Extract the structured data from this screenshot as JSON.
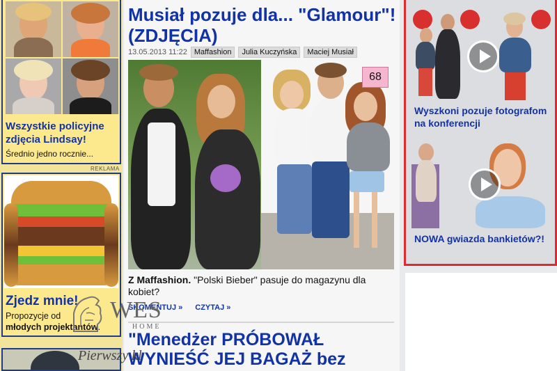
{
  "left": {
    "lindsay_headline": "Wszystkie policyjne zdjęcia Lindsay!",
    "lindsay_sub": "Średnio jedno rocznie...",
    "ad_label": "REKLAMA",
    "burger_title": "Zjedz mnie!",
    "burger_sub_plain": "Propozycje od",
    "burger_sub_bold": "młodych projektantów",
    "burger_sub_end": "."
  },
  "main": {
    "title": "Musiał pozuje dla... \"Glamour\"! (ZDJĘCIA)",
    "date": "13.05.2013 11:22",
    "tags": [
      "Maffashion",
      "Julia Kuczyńska",
      "Maciej Musiał"
    ],
    "photo_count": "68",
    "caption_bold": "Z Maffashion.",
    "caption_text": " \"Polski Bieber\" pasuje do magazynu dla kobiet?",
    "link_comment": "SKOMENTUJ »",
    "link_read": "CZYTAJ »",
    "second_title": "\"Menedżer PRÓBOWAŁ WYNIEŚĆ JEJ BAGAŻ bez"
  },
  "right": {
    "video1_title": "Wyszkoni pozuje fotografom na konferencji",
    "video2_title": "NOWA gwiazda bankietów?!",
    "ad_brand": "WES",
    "ad_brand_sub": "HOME",
    "ad_script": "Pierwszy kl"
  },
  "colors": {
    "link_blue": "#1233a5",
    "video_border": "#e3282f",
    "left_bg": "#fde98d",
    "badge_pink": "#f6b6cf"
  }
}
